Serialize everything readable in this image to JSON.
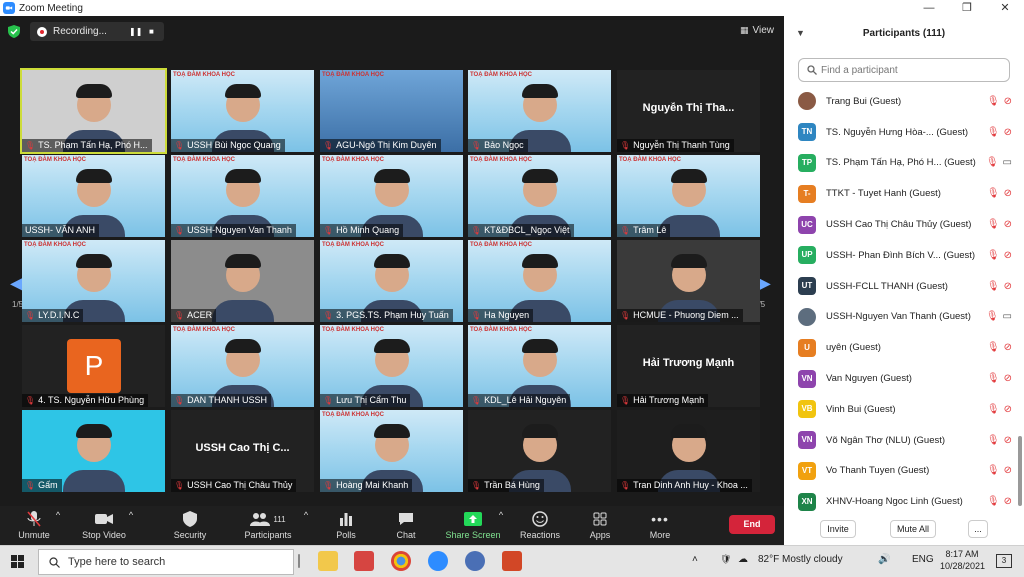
{
  "window": {
    "title": "Zoom Meeting",
    "controls": [
      "—",
      "❐",
      "✕"
    ]
  },
  "recording": {
    "label": "Recording...",
    "pause": "❚❚",
    "stop": "■"
  },
  "view": {
    "label": "View"
  },
  "pager": {
    "left": "1/5",
    "right": "1/5"
  },
  "slide_banner": "TOẠ ĐÀM KHOA HỌC",
  "tiles": [
    {
      "label": "TS. Phạm Tấn Hạ, Phó H...",
      "muted": true
    },
    {
      "label": "USSH Bùi Ngọc Quang",
      "muted": true
    },
    {
      "label": "AGU-Ngô Thị Kim Duyên",
      "muted": true
    },
    {
      "label": "Bảo Ngọc",
      "muted": true
    },
    {
      "label": "Nguyễn Thị Thanh Tùng",
      "muted": true,
      "bigname": "Nguyễn Thị Tha..."
    },
    {
      "label": "USSH- VÂN ANH",
      "muted": false
    },
    {
      "label": "USSH-Nguyen Van Thanh",
      "muted": true
    },
    {
      "label": "Hồ Minh Quang",
      "muted": true
    },
    {
      "label": "KT&ĐBCL_Ngọc Việt",
      "muted": true
    },
    {
      "label": "Trâm Lê",
      "muted": true
    },
    {
      "label": "LY.D.I.N.C",
      "muted": true
    },
    {
      "label": "ACER",
      "muted": true
    },
    {
      "label": "3. PGS.TS. Phạm Huy Tuấn",
      "muted": true
    },
    {
      "label": "Ha Nguyen",
      "muted": true
    },
    {
      "label": "HCMUE - Phuong Diem ...",
      "muted": true
    },
    {
      "label": "4. TS. Nguyễn Hữu Phùng",
      "muted": true,
      "initial": "P"
    },
    {
      "label": "DAN THANH USSH",
      "muted": true
    },
    {
      "label": "Lưu Thị Cẩm Thu",
      "muted": true
    },
    {
      "label": "KDL_Lê Hải Nguyên",
      "muted": true
    },
    {
      "label": "Hải Trương Mạnh",
      "muted": true,
      "bigname": "Hải Trương Mạnh"
    },
    {
      "label": "Gấm",
      "muted": true
    },
    {
      "label": "USSH Cao Thị Châu Thủy",
      "muted": true,
      "bigname": "USSH Cao Thị C..."
    },
    {
      "label": "Hoàng Mai Khanh",
      "muted": true
    },
    {
      "label": "Trần Bá Hùng",
      "muted": true
    },
    {
      "label": "Tran Dinh Anh Huy - Khoa ...",
      "muted": true
    }
  ],
  "toolbar": {
    "unmute": "Unmute",
    "stop_video": "Stop Video",
    "security": "Security",
    "participants": "Participants",
    "participants_count": "111",
    "polls": "Polls",
    "chat": "Chat",
    "share_screen": "Share Screen",
    "reactions": "Reactions",
    "apps": "Apps",
    "more": "More",
    "end": "End"
  },
  "participants_panel": {
    "title": "Participants (111)",
    "search_placeholder": "Find a participant",
    "invite": "Invite",
    "mute_all": "Mute All",
    "more": "...",
    "items": [
      {
        "initials": "",
        "name": "Trang Bui (Guest)",
        "color": "#8a5a44",
        "video": "off"
      },
      {
        "initials": "TN",
        "name": "TS. Nguyễn Hưng Hòa-...  (Guest)",
        "color": "#2e86c1",
        "video": "off"
      },
      {
        "initials": "TP",
        "name": "TS. Phạm Tấn Hạ, Phó H... (Guest)",
        "color": "#27ae60",
        "video": "on"
      },
      {
        "initials": "T-",
        "name": "TTKT - Tuyet Hanh (Guest)",
        "color": "#e67e22",
        "video": "off"
      },
      {
        "initials": "UC",
        "name": "USSH Cao Thị Châu Thủy (Guest)",
        "color": "#8e44ad",
        "video": "off"
      },
      {
        "initials": "UP",
        "name": "USSH- Phan Đình Bích V... (Guest)",
        "color": "#27ae60",
        "video": "off"
      },
      {
        "initials": "UT",
        "name": "USSH-FCLL THANH (Guest)",
        "color": "#2c3e50",
        "video": "off"
      },
      {
        "initials": "",
        "name": "USSH-Nguyen Van Thanh (Guest)",
        "color": "#5d6d7e",
        "video": "on"
      },
      {
        "initials": "U",
        "name": "uyên (Guest)",
        "color": "#e67e22",
        "video": "off"
      },
      {
        "initials": "VN",
        "name": "Van Nguyen (Guest)",
        "color": "#8e44ad",
        "video": "off"
      },
      {
        "initials": "VB",
        "name": "Vinh Bui (Guest)",
        "color": "#f1c40f",
        "video": "off"
      },
      {
        "initials": "VN",
        "name": "Võ Ngân Thơ (NLU) (Guest)",
        "color": "#8e44ad",
        "video": "off"
      },
      {
        "initials": "VT",
        "name": "Vo Thanh Tuyen (Guest)",
        "color": "#f1a10f",
        "video": "off"
      },
      {
        "initials": "XN",
        "name": "XHNV-Hoang Ngoc Linh (Guest)",
        "color": "#1e8449",
        "video": "off"
      }
    ]
  },
  "taskbar": {
    "search_placeholder": "Type here to search",
    "weather": "82°F  Mostly cloudy",
    "lang": "ENG",
    "time": "8:17 AM",
    "date": "10/28/2021",
    "notif": "3"
  }
}
